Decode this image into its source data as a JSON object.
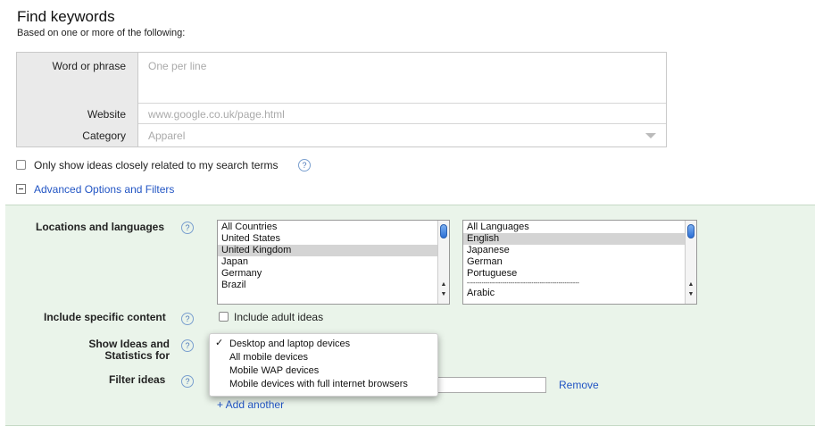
{
  "header": {
    "title": "Find keywords",
    "subtitle": "Based on one or more of the following:"
  },
  "form": {
    "word_label": "Word or phrase",
    "word_placeholder": "One per line",
    "website_label": "Website",
    "website_placeholder": "www.google.co.uk/page.html",
    "category_label": "Category",
    "category_value": "Apparel"
  },
  "only_show": {
    "label": "Only show ideas closely related to my search terms",
    "checked": false
  },
  "advanced": {
    "toggle_icon": "minus-box-icon",
    "label": "Advanced Options and Filters"
  },
  "locations": {
    "label": "Locations and languages",
    "countries": [
      "All Countries",
      "United States",
      "United Kingdom",
      "Japan",
      "Germany",
      "Brazil"
    ],
    "selected_country": "United Kingdom",
    "languages": [
      "All Languages",
      "English",
      "Japanese",
      "German",
      "Portuguese",
      "------------------------------------------------------",
      "Arabic"
    ],
    "selected_language": "English"
  },
  "include_content": {
    "label": "Include specific content",
    "checkbox_label": "Include adult ideas",
    "checked": false
  },
  "show_ideas": {
    "label_line1": "Show Ideas and",
    "label_line2": "Statistics for",
    "check_mark": "✓",
    "options": [
      "Desktop and laptop devices",
      "All mobile devices",
      "Mobile WAP devices",
      "Mobile devices with full internet browsers"
    ],
    "selected": "Desktop and laptop devices"
  },
  "filter_ideas": {
    "label": "Filter ideas",
    "remove_label": "Remove",
    "add_label": "+ Add another"
  },
  "help_icon_text": "?",
  "colors": {
    "link": "#2255c4",
    "panel_green": "#eaf4ea",
    "selection": "#d4d4d4"
  }
}
